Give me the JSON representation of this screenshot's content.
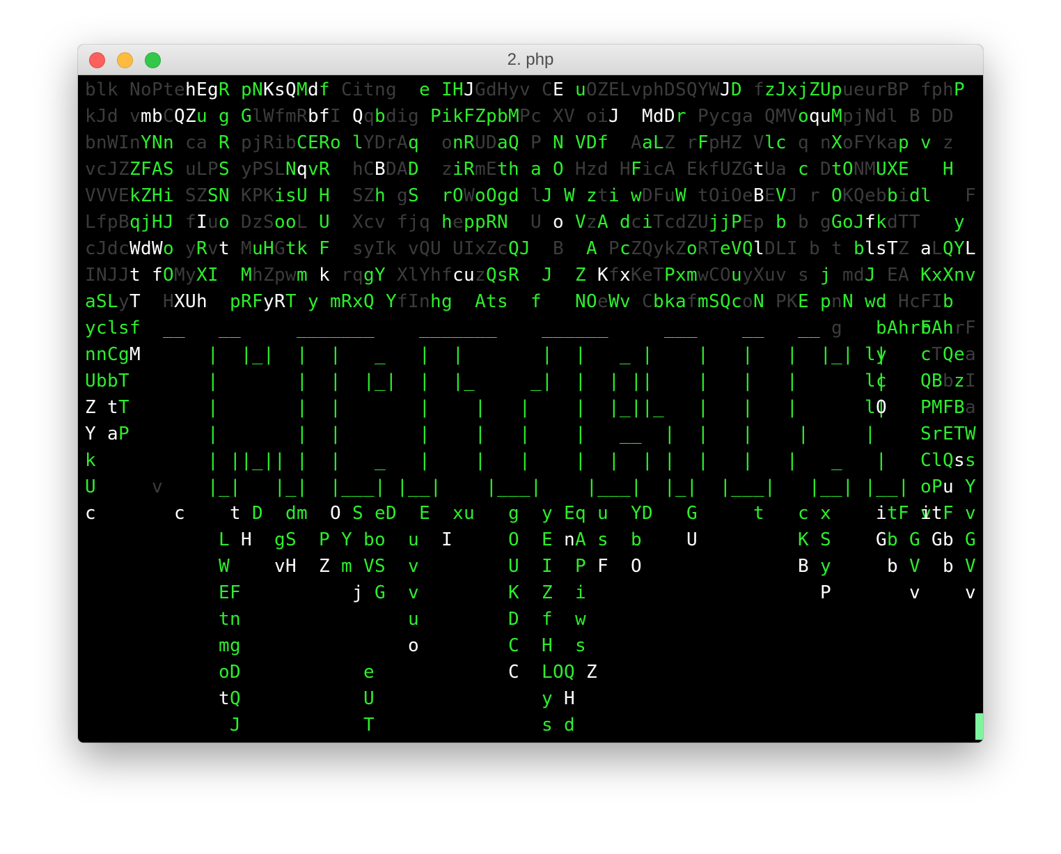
{
  "window": {
    "title": "2. php"
  },
  "colors": {
    "bright": "#ffffff",
    "green": "#2dee2d",
    "dim": "#3c3c3c",
    "background": "#000000",
    "cursor": "#7ff5a0"
  },
  "terminal": {
    "rows": [
      {
        "fg": "DDDDDDDDDBBBGGGGBBB BGGDDDDDDGGGGGBDDDDD DBGGDDDDDDDDDDDDBGDDGGGGGG DDDDDDDDDD DGBBGDDDDDDDGDDDDDDDGBGDDDDDDDDDDDDDDDDDDDDDGBGGDDDDDDDDGD GGDGG",
        "text": "blk NoPtehEgR pNKsQMdf Citng  e IHJGdHyv CE uOZELvphDSQYWJD fzJxjZUpueurBP fphP"
      },
      {
        "fg": "DDD DBBDBBG GG DDDDDBBDDBD DDDDGGGGGG GDDDDDDDDBD BBB DDDDDDDDDD BBGDDDDDDDDDD GGBBGBDDBGGDDDDDDDDGGG BBGG BBD",
        "text": "kJd vmbCQZu g GlWfmRbfI Qqbdig PikFZpbMPc XV oiJ  MdDr Pycga QMVoquMpjNdl B DD"
      },
      {
        "fg": "DDDDDGGG DD G DDDDDGGGGB DDDDG DD  DDGGDDDG G GDDD GDDD DDDDDG GD D DDDDDGG GD D",
        "text": "bnWInYNn ca R pjRibCERo lYDrAq  onRUDaQ P N VDf  AaLZ rFpHZ Vlc q nXoFYkap v z"
      },
      {
        "fg": "DDDDGGGG DDDG DDDDGBGG DDDBDD  DDGGDDGG G G DDD DGDDD DDDDDDBDD G DGGDDGGG    D",
        "text": "vcJZZFAS uLPS yPSLNqvR  hCBDAD  ziRmEth a O Hzd HFicA EkfUZGtUa c DtONMUXE   H"
      },
      {
        "fg": "DDDDGGG DDDG DDDDGG G  DDD DD  DGGDGGG BD G DGD DGDDD DDDDDDBD D DDGDDDD D     D",
        "text": "VVVEkZHi SZSN KPKisU H  SZh gS  rOWoOgd lJ W zti wDFuW tOiOeBEVJ r OKQebbidl   F"
      },
      {
        "fg": "DDDDGGG DDBD DDDDGGD G  DDD DDD  DGGGG  D B GDG  DGDDDDDGGGDDD DD D GGBGDDDBDG   D",
        "text": "LfpBqjHJ fIuo DzSooL U  Xcv fjq heppRN  U o VzA dciTcdZUjjPEp b b gGoJfkdTT   y"
      },
      {
        "fg": "DDDDBBBGGDGDB DGGDGG G  DDDD DDD DDDDDGG  D  G DGDDDDDGDDGGGBDDD D D GBBBDDBDGGBDDD",
        "text": "cJdcWdWo yRvt MuHGtk F  syIk vQU UIxZcQJ  B  A PcZQykZoRTeVQlDLI b t blsTZ aLQYL"
      },
      {
        "fg": "DDDDBBBGDD  DG DDDDGGB DDGG DDDDDBBDGG  D  B DBDBDDDGGGDDD DDDD DGGDDDGDDDD",
        "text": "INJJt fOMyXI  MhZpwm k rqgY XlYhfcuzQsR  J  Z KfxKeTPxmwCOuyXuv s j mdJ EA KxXnv"
      },
      {
        "fg": "GGGDB  DBBB DGGGBB G DGGG GGDDDGG GGG  D  BG GDGGGDGGGDGGGGD DDD GGD GG BDDDD",
        "text": "aSLyT  HXUh  pRFyRT y mRxQ YfInhg  Ats  f   NOeWv CbkafmSQcoN PKE pnN wd HcFIb"
      },
      {
        "fg": "GGGGG                                                      G   GGGDD",
        "text": "yclsf  __   __     _______    _______    ______     ___    __   __ g   bAhrF"
      },
      {
        "fg": "GGGGB",
        "text": "nnCgM"
      },
      {
        "fg": "GGGG",
        "text": "UbbT"
      },
      {
        "fg": "B BG",
        "text": "Z tT"
      },
      {
        "fg": "B BG",
        "text": "Y aP"
      },
      {
        "fg": "G",
        "text": "k"
      },
      {
        "fg": "G",
        "text": "U"
      },
      {
        "fg": "B",
        "text": "c"
      }
    ],
    "banner": [
      "       |  |_|  |  |   _   |  |       |  |   _ |    |   |   |  |_|  |",
      "       |       |  |  |_|  |  |_     _|  |  | ||    |   |   |       |",
      "       |       |  |       |    |   |    |  |_||_   |   |   |       |",
      "       |       |  |       |    |   |    |   __  |  |   |    |     |",
      "       | ||_|| |  |   _   |    |   |    |  |  | |  |   |   |   _   |",
      "       |_|   |_|  |___| |__|    |___|    |___|  |_|  |___|   |__| |__|"
    ],
    "rain_bottom": [
      {
        "fg": "        B    B G  G  GB  G GB   B     G  GB  G  G   B     B     G      B    G G",
        "text": "        c    t D  dm  O S eD  E  xu   g  y Eq u  YD   G     t   c x    itF v"
      },
      {
        "fg": "            G B  GG  G G GG  G  B     G  G BG G  G    B         G G    BG G",
        "text": "            L H  gS  P Y bo  u  I     O  E nA s  b    U         K S    Gb G"
      },
      {
        "fg": "            G    BB  B G GG  G        G  G  G B  B              B G     B G",
        "text": "            W    vH  Z m VS  v        U  I  P F  O              B y     b V"
      },
      {
        "fg": "            GG          B G  G        G  G  G                     B       B",
        "text": "            EF          j G  v        K  Z  i                     P       v"
      },
      {
        "fg": "            GG               G        G  G  G",
        "text": "            tn               u        D  f  w"
      },
      {
        "fg": "            GG               B        G  G  G",
        "text": "            mg               o        C  H  s"
      },
      {
        "fg": "            GG           G            B  GGG B",
        "text": "            oD           e            C  LOQ Z"
      },
      {
        "fg": "            BG           G               G B",
        "text": "            tQ           U               y H"
      },
      {
        "fg": "             G           G               G G",
        "text": "             J           T               s d"
      }
    ],
    "right_column": [
      {
        "fg": "GGGDD",
        "text": "bAhrF"
      },
      {
        "fg": "GDGGD",
        "text": "cTQea"
      },
      {
        "fg": "GGDGD",
        "text": "QBbzI"
      },
      {
        "fg": "GGGGD",
        "text": "PMFBa"
      },
      {
        "fg": "GGGGG",
        "text": "SrETW"
      },
      {
        "fg": "GGGBG",
        "text": "ClQss"
      },
      {
        "fg": "GGB G",
        "text": "oPu Y"
      },
      {
        "fg": "BBG G",
        "text": "itF v"
      },
      {
        "fg": " BB G",
        "text": " Gb G"
      },
      {
        "fg": "  B G",
        "text": "  b V"
      },
      {
        "fg": "    B",
        "text": "    v"
      }
    ],
    "banner_right": [
      {
        "fg": "GG",
        "text": "ly"
      },
      {
        "fg": "GG",
        "text": "lc"
      },
      {
        "fg": "GB",
        "text": "lO"
      }
    ],
    "side_letters": [
      {
        "text": "v",
        "fg": "D"
      }
    ]
  }
}
